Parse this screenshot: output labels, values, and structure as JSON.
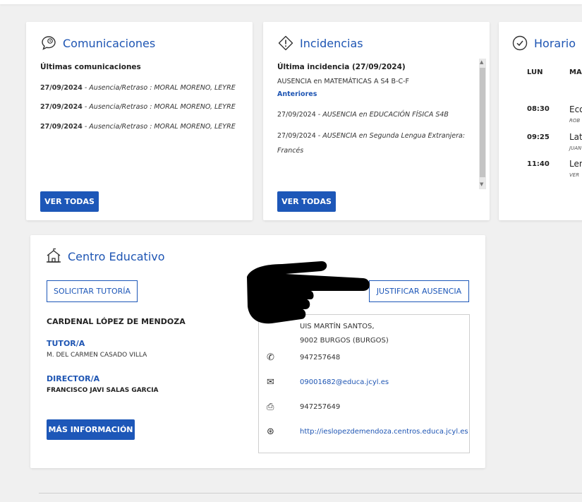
{
  "comunicaciones": {
    "title": "Comunicaciones",
    "subtitle": "Últimas comunicaciones",
    "items": [
      {
        "date": "27/09/2024",
        "text": " - Ausencia/Retraso : MORAL MORENO, LEYRE"
      },
      {
        "date": "27/09/2024",
        "text": " - Ausencia/Retraso : MORAL MORENO, LEYRE"
      },
      {
        "date": "27/09/2024",
        "text": " - Ausencia/Retraso : MORAL MORENO, LEYRE"
      }
    ],
    "button": "VER TODAS"
  },
  "incidencias": {
    "title": "Incidencias",
    "latest_label": "Última incidencia (27/09/2024)",
    "latest_text": "AUSENCIA en MATEMÁTICAS A S4 B-C-F",
    "previous_link": "Anteriores",
    "items": [
      {
        "date": "27/09/2024",
        "text": " - AUSENCIA en EDUCACIÓN FÍSICA S4B"
      },
      {
        "date": "27/09/2024",
        "text": " - AUSENCIA en Segunda Lengua Extranjera:"
      }
    ],
    "item2_cont": "Francés",
    "button": "VER TODAS"
  },
  "horario": {
    "title": "Horario",
    "days": [
      "LUN",
      "MA"
    ],
    "rows": [
      {
        "time": "08:30",
        "subject": "Eco",
        "teacher": "ROB"
      },
      {
        "time": "09:25",
        "subject": "Lat",
        "teacher": "JUAN"
      },
      {
        "time": "11:40",
        "subject": "Len",
        "teacher": "VER"
      }
    ]
  },
  "centro": {
    "title": "Centro Educativo",
    "btn_tutoria": "SOLICITAR TUTORÍA",
    "btn_justificar": "JUSTIFICAR AUSENCIA",
    "school_name": "CARDENAL LÓPEZ DE MENDOZA",
    "tutor_label": "TUTOR/A",
    "tutor_name": "M. DEL CARMEN CASADO VILLA",
    "director_label": "DIRECTOR/A",
    "director_name": "FRANCISCO JAVI SALAS GARCIA",
    "btn_mas": "MÁS INFORMACIÓN",
    "address1": "UIS MARTÍN SANTOS,",
    "address2": "9002 BURGOS (BURGOS)",
    "phone": "947257648",
    "email": "09001682@educa.jcyl.es",
    "fax": "947257649",
    "web": "http://ieslopezdemendoza.centros.educa.jcyl.es"
  },
  "icons": {
    "comunicaciones": "chat-bubble-icon",
    "incidencias": "warning-diamond-icon",
    "horario": "clock-icon",
    "centro": "school-building-icon",
    "phone": "phone-icon",
    "email": "mail-icon",
    "fax": "fax-icon",
    "web": "globe-icon",
    "pointer": "pointing-hand-icon"
  },
  "colors": {
    "accent": "#1d57b8",
    "link": "#1e55b3",
    "background": "#f0f0f0"
  }
}
